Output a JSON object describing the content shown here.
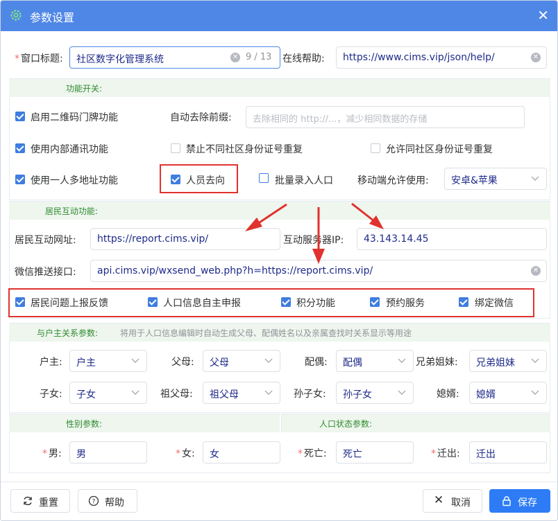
{
  "window": {
    "title": "参数设置"
  },
  "basic": {
    "window_title_label": "窗口标题:",
    "window_title_value": "社区数字化管理系统",
    "window_title_counter": "9 / 13",
    "help_label": "在线帮助:",
    "help_value": "https://www.cims.vip/json/help/"
  },
  "features": {
    "band_title": "功能开关:",
    "qr_label": "启用二维码门牌功能",
    "prefix_label": "自动去除前缀:",
    "prefix_placeholder": "去除相同的 http://...，减少相同数据的存储",
    "internal_comm_label": "使用内部通讯功能",
    "forbid_dup_id_label": "禁止不同社区身份证号重复",
    "allow_dup_id_label": "允许同社区身份证号重复",
    "multi_addr_label": "使用一人多地址功能",
    "person_whereabouts_label": "人员去向",
    "batch_entry_label": "批量录入人口",
    "mobile_label": "移动端允许使用:",
    "mobile_value": "安卓&苹果"
  },
  "interaction": {
    "band_title": "居民互动功能:",
    "url_label": "居民互动网址:",
    "url_value": "https://report.cims.vip/",
    "server_ip_label": "互动服务器IP:",
    "server_ip_value": "43.143.14.45",
    "wechat_label": "微信推送接口:",
    "wechat_value": "api.cims.vip/wxsend_web.php?h=https://report.cims.vip/",
    "feedback_label": "居民问题上报反馈",
    "self_report_label": "人口信息自主申报",
    "points_label": "积分功能",
    "appointment_label": "预约服务",
    "bind_wechat_label": "绑定微信"
  },
  "relations": {
    "band_title": "与户主关系参数:",
    "band_note": "将用于人口信息编辑时自动生成父母、配偶姓名以及亲属查找时关系显示等用途",
    "householder_label": "户主:",
    "householder_value": "户主",
    "parents_label": "父母:",
    "parents_value": "父母",
    "spouse_label": "配偶:",
    "spouse_value": "配偶",
    "siblings_label": "兄弟姐妹:",
    "siblings_value": "兄弟姐妹",
    "children_label": "子女:",
    "children_value": "子女",
    "grandparents_label": "祖父母:",
    "grandparents_value": "祖父母",
    "grandchildren_label": "孙子女:",
    "grandchildren_value": "孙子女",
    "daughter_in_law_label": "媳婿:",
    "daughter_in_law_value": "媳婿"
  },
  "gender": {
    "band_title": "性别参数:",
    "male_label": "男:",
    "male_value": "男",
    "female_label": "女:",
    "female_value": "女"
  },
  "status": {
    "band_title": "人口状态参数:",
    "dead_label": "死亡:",
    "dead_value": "死亡",
    "moved_label": "迁出:",
    "moved_value": "迁出"
  },
  "footer": {
    "reset_label": "重置",
    "help_label": "帮助",
    "cancel_label": "取消",
    "save_label": "保存"
  },
  "colors": {
    "accent": "#4f87e6",
    "primary": "#2d7cf6",
    "highlight": "#e0322e",
    "band": "#eef6ee"
  }
}
